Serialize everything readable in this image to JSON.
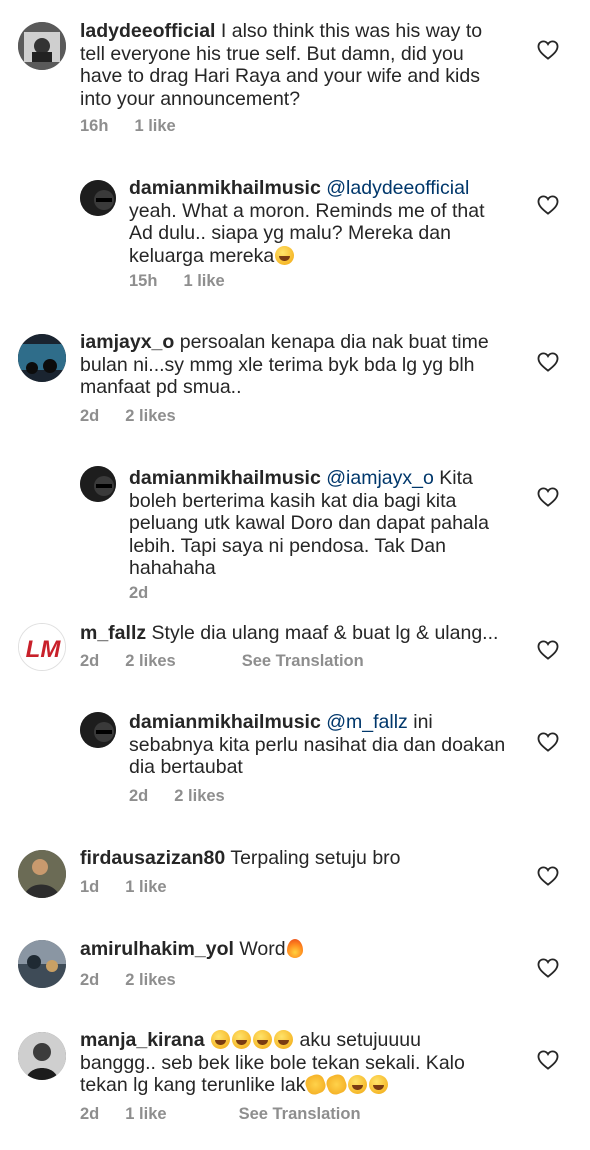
{
  "comments": [
    {
      "username": "ladydeeofficial",
      "text": "I also think this was his way to tell everyone his true self. But damn, did you have to drag Hari Raya and your wife and kids into your announcement?",
      "time": "16h",
      "likes": "1 like",
      "extra": ""
    },
    {
      "username": "damianmikhailmusic",
      "mention": "@ladydeeofficial",
      "text": "yeah. What a moron. Reminds me of that Ad dulu.. siapa yg malu? Mereka dan keluarga mereka",
      "emoji": "laughing-emoji",
      "time": "15h",
      "likes": "1 like",
      "extra": ""
    },
    {
      "username": "iamjayx_o",
      "text": "persoalan kenapa dia nak buat time bulan ni...sy mmg xle terima byk bda lg yg blh manfaat pd smua..",
      "time": "2d",
      "likes": "2 likes",
      "extra": ""
    },
    {
      "username": "damianmikhailmusic",
      "mention": "@iamjayx_o",
      "text": "Kita boleh berterima kasih kat dia bagi kita peluang utk kawal Doro dan dapat pahala lebih. Tapi saya ni pendosa. Tak Dan hahahaha",
      "time": "2d",
      "likes": "",
      "extra": ""
    },
    {
      "username": "m_fallz",
      "text": "Style dia ulang maaf & buat lg & ulang...",
      "time": "2d",
      "likes": "2 likes",
      "extra": "See Translation"
    },
    {
      "username": "damianmikhailmusic",
      "mention": "@m_fallz",
      "text": "ini sebabnya kita perlu nasihat dia dan doakan dia bertaubat",
      "time": "2d",
      "likes": "2 likes",
      "extra": ""
    },
    {
      "username": "firdausazizan80",
      "text": "Terpaling setuju bro",
      "time": "1d",
      "likes": "1 like",
      "extra": ""
    },
    {
      "username": "amirulhakim_yol",
      "text": "Word",
      "emoji": "fire-emoji",
      "time": "2d",
      "likes": "2 likes",
      "extra": ""
    },
    {
      "username": "manja_kirana",
      "text_a": "aku setujuuuu banggg.. seb bek like bole tekan sekali. Kalo tekan lg kang terunlike lak",
      "emoji_lead": "laughing-emoji x4",
      "emoji_trail": "clapping-emoji x2, laughing-emoji x2",
      "time": "2d",
      "likes": "1 like",
      "extra": "See Translation"
    }
  ],
  "icons": {
    "like": "heart-icon"
  },
  "colors": {
    "text": "#262626",
    "meta": "#8e8e8e",
    "mention": "#00376b"
  }
}
